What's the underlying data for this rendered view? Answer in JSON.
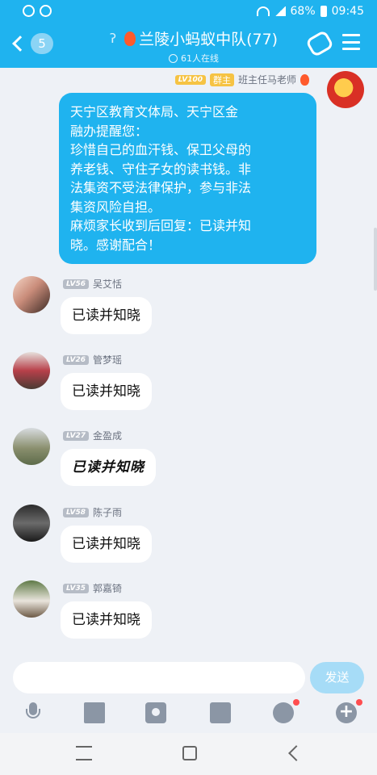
{
  "status_bar": {
    "battery": "68%",
    "time": "09:45"
  },
  "header": {
    "back_count": "5",
    "group_name": "兰陵小蚂蚁中队(77)",
    "online": "61人在线"
  },
  "teacher_message": {
    "level": "LV100",
    "role": "群主",
    "sender": "班主任马老师",
    "lines": [
      "天宁区教育文体局、天宁区金",
      "融办提醒您：",
      "珍惜自己的血汗钱、保卫父母的",
      "养老钱、守住子女的读书钱。非",
      "法集资不受法律保护，参与非法",
      "集资风险自担。",
      "麻烦家长收到后回复：已读并知",
      "晓。感谢配合！"
    ]
  },
  "replies": [
    {
      "level": "LV56",
      "sender": "吴艾恬",
      "text": "已读并知晓"
    },
    {
      "level": "LV26",
      "sender": "管梦瑶",
      "text": "已读并知晓"
    },
    {
      "level": "LV27",
      "sender": "金盈成",
      "text": "已读并知晓"
    },
    {
      "level": "LV58",
      "sender": "陈子雨",
      "text": "已读并知晓"
    },
    {
      "level": "LV35",
      "sender": "郭嘉锜",
      "text": "已读并知晓"
    }
  ],
  "input": {
    "placeholder": "",
    "send_label": "发送"
  },
  "icons": {
    "toolbar": [
      "microphone-icon",
      "image-icon",
      "camera-icon",
      "red-packet-icon",
      "emoji-icon",
      "plus-icon"
    ],
    "accent": "#1fb3ef"
  }
}
